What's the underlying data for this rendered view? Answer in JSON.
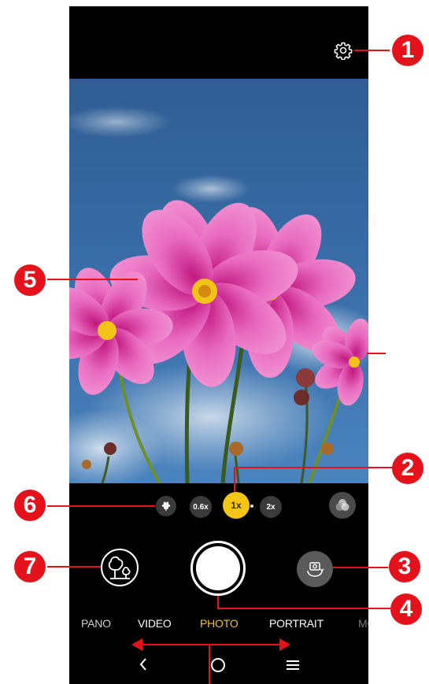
{
  "modes": {
    "pano": "PANO",
    "video": "VIDEO",
    "photo": "PHOTO",
    "portrait": "PORTRAIT",
    "more": "MO"
  },
  "zoom": {
    "macro_icon": "flower-icon",
    "wide": "0.6x",
    "normal": "1x",
    "tele": "2x"
  },
  "callouts": [
    "1",
    "2",
    "3",
    "4",
    "5",
    "6",
    "7"
  ],
  "colors": {
    "accent": "#f5c518",
    "callout": "#e6121b",
    "photo_mode": "#f1c232"
  }
}
